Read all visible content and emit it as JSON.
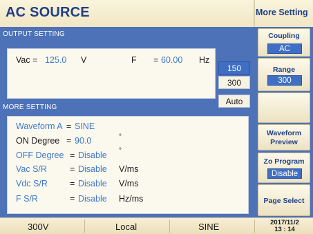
{
  "header": {
    "title": "AC SOURCE",
    "panel_title": "More Setting"
  },
  "output_setting": {
    "section_label": "OUTPUT SETTING",
    "vac_label": "Vac =",
    "vac_value": "125.0",
    "vac_unit": "V",
    "freq_label": "F",
    "freq_eq": "=",
    "freq_value": "60.00",
    "freq_unit": "Hz"
  },
  "range_options": [
    "150",
    "300",
    "Auto"
  ],
  "range_selected_index": 0,
  "more_setting": {
    "section_label": "MORE SETTING",
    "rows": [
      {
        "label": "Waveform A",
        "eq": "=",
        "value": "SINE",
        "unit": ""
      },
      {
        "label": "ON Degree",
        "eq": "=",
        "value": "90.0",
        "unit": "°"
      },
      {
        "label": "OFF Degree",
        "eq": "=",
        "value": "Disable",
        "unit": "°"
      },
      {
        "label": "Vac S/R",
        "eq": "=",
        "value": "Disable",
        "unit": "V/ms"
      },
      {
        "label": "Vdc S/R",
        "eq": "=",
        "value": "Disable",
        "unit": "V/ms"
      },
      {
        "label": "F S/R",
        "eq": "=",
        "value": "Disable",
        "unit": "Hz/ms"
      }
    ]
  },
  "softkeys": {
    "coupling_label": "Coupling",
    "coupling_value": "AC",
    "range_label": "Range",
    "range_value": "300",
    "waveform_preview_line1": "Waveform",
    "waveform_preview_line2": "Preview",
    "zo_program_label": "Zo Program",
    "zo_program_value": "Disable",
    "page_select_label": "Page Select"
  },
  "status_bar": {
    "voltage_range": "300V",
    "control_mode": "Local",
    "waveform": "SINE",
    "date": "2017/11/2",
    "time": "13 : 14"
  },
  "colors": {
    "panel_blue": "#4d72b8",
    "value_blue": "#3f79c8",
    "highlight_blue": "#3f6fc4",
    "cream": "#f4ecd2"
  }
}
